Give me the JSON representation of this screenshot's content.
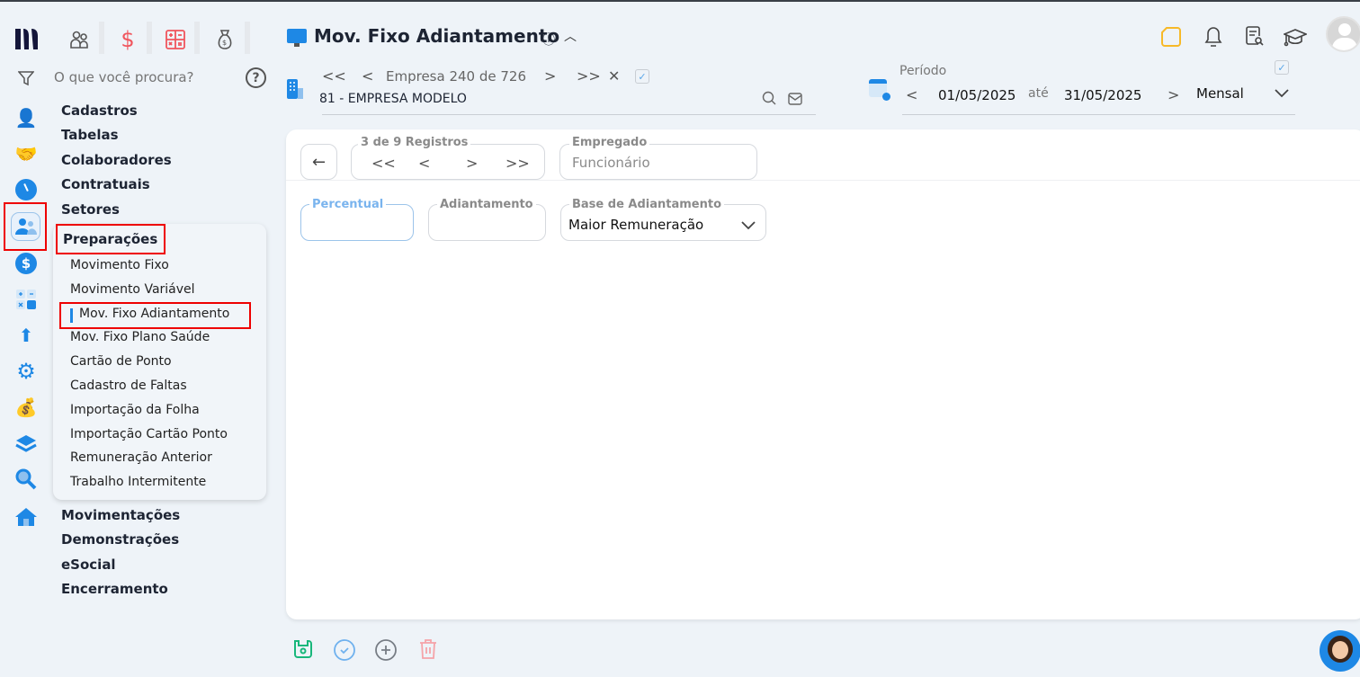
{
  "app": {
    "logo": "logo-icon",
    "top_icons": [
      "people-icon",
      "dollar-icon",
      "calculator-icon",
      "money-bag-icon"
    ],
    "accent": "#1e88e5",
    "highlight": "#e00000"
  },
  "search": {
    "placeholder": "O que você procura?"
  },
  "menu": {
    "groups_top": [
      "Cadastros",
      "Tabelas",
      "Colaboradores",
      "Contratuais",
      "Setores"
    ],
    "expanded": {
      "label": "Preparações",
      "items": [
        "Movimento Fixo",
        "Movimento Variável",
        "Mov. Fixo Adiantamento",
        "Mov. Fixo Plano Saúde",
        "Cartão de Ponto",
        "Cadastro de Faltas",
        "Importação da Folha",
        "Importação Cartão Ponto",
        "Remuneração Anterior",
        "Trabalho Intermitente"
      ],
      "active_index": 2
    },
    "groups_bottom": [
      "Movimentações",
      "Demonstrações",
      "eSocial",
      "Encerramento"
    ]
  },
  "header": {
    "title": "Mov. Fixo Adiantamento",
    "info_icon": "ⓘ",
    "company_nav": {
      "first": "<<",
      "prev": "<",
      "label": "Empresa 240 de 726",
      "next": ">",
      "last": ">>",
      "clear": "✕"
    },
    "company": "81 - EMPRESA MODELO",
    "period": {
      "label": "Período",
      "start": "01/05/2025",
      "sep": "até",
      "end": "31/05/2025",
      "type": "Mensal"
    }
  },
  "form": {
    "records": {
      "label": "3 de 9 Registros",
      "first": "<<",
      "prev": "<",
      "next": ">",
      "last": ">>"
    },
    "employee": {
      "label": "Empregado",
      "placeholder": "Funcionário"
    },
    "percent": {
      "label": "Percentual",
      "value": ""
    },
    "advance": {
      "label": "Adiantamento",
      "value": ""
    },
    "base": {
      "label": "Base de Adiantamento",
      "value": "Maior Remuneração"
    }
  }
}
